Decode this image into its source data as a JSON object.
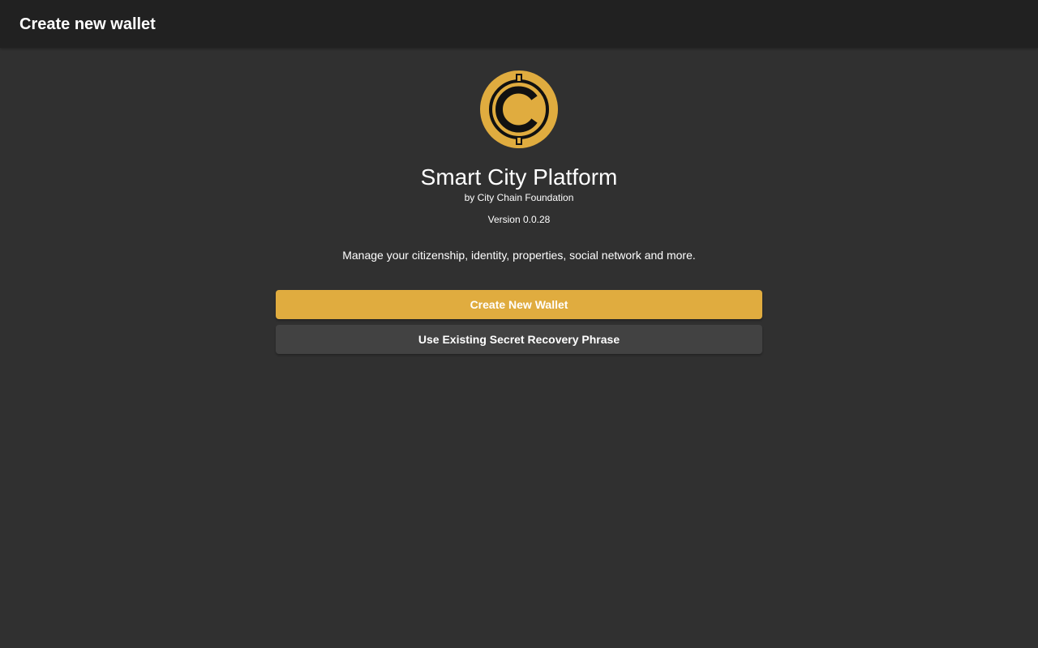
{
  "header": {
    "title": "Create new wallet"
  },
  "app": {
    "logo_icon": "city-chain-coin-logo",
    "name": "Smart City Platform",
    "byline": "by City Chain Foundation",
    "version": "Version 0.0.28",
    "tagline": "Manage your citizenship, identity, properties, social network and more."
  },
  "actions": {
    "create_label": "Create New Wallet",
    "restore_label": "Use Existing Secret Recovery Phrase"
  },
  "colors": {
    "background": "#303030",
    "toolbar": "#212121",
    "accent": "#e0ac3f",
    "secondary_button": "#424242"
  }
}
